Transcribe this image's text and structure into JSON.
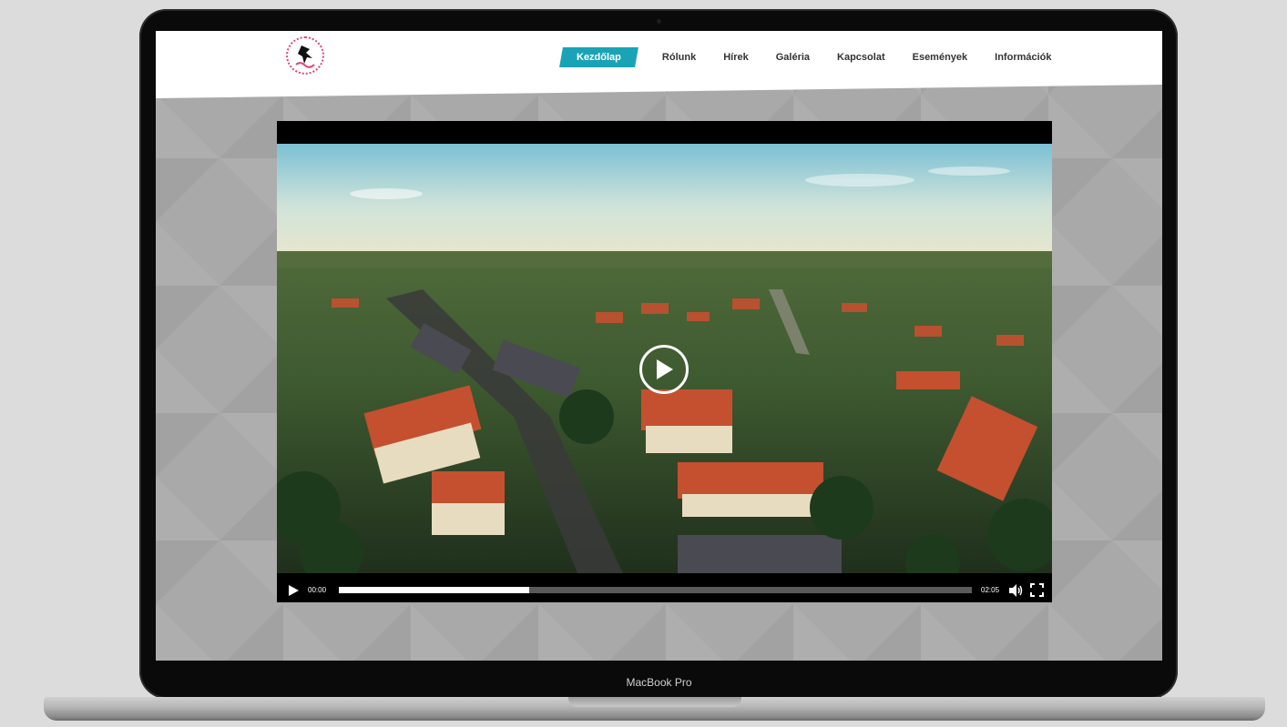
{
  "device": {
    "label": "MacBook Pro"
  },
  "site": {
    "logo_icon": "logo-icon",
    "nav": {
      "items": [
        {
          "label": "Kezdőlap",
          "active": true
        },
        {
          "label": "Rólunk",
          "active": false
        },
        {
          "label": "Hírek",
          "active": false
        },
        {
          "label": "Galéria",
          "active": false
        },
        {
          "label": "Kapcsolat",
          "active": false
        },
        {
          "label": "Események",
          "active": false
        },
        {
          "label": "Információk",
          "active": false
        }
      ]
    },
    "accent_color": "#1aa3b6"
  },
  "video_player": {
    "current_time": "00:00",
    "duration": "02:05",
    "progress_fraction": 0.3,
    "big_play_icon": "play-circle-icon",
    "play_icon": "play-icon",
    "volume_icon": "volume-icon",
    "fullscreen_icon": "fullscreen-icon"
  }
}
